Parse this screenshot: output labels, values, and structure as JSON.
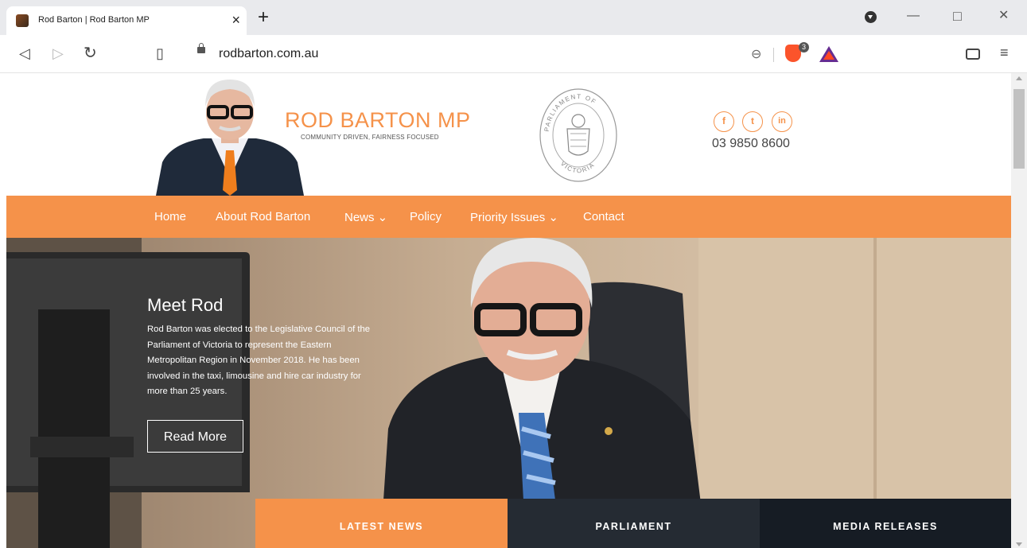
{
  "browser": {
    "tab_title": "Rod Barton | Rod Barton MP",
    "tab_close": "×",
    "new_tab": "+",
    "url": "rodbarton.com.au",
    "shields_count": "3",
    "window": {
      "minimize": "—",
      "maximize": "□",
      "close": "✕"
    },
    "nav": {
      "back": "◁",
      "forward": "▷",
      "reload": "↻",
      "bookmark": "▯",
      "zoom": "⊖",
      "menu": "≡"
    }
  },
  "header": {
    "title": "ROD BARTON MP",
    "tagline": "COMMUNITY DRIVEN, FAIRNESS FOCUSED",
    "seal_text_top": "PARLIAMENT OF",
    "seal_text_bottom": "VICTORIA",
    "social": {
      "facebook": "f",
      "twitter": "t",
      "linkedin": "in"
    },
    "phone": "03 9850 8600"
  },
  "main_nav": [
    {
      "label": "Home"
    },
    {
      "label": "About Rod Barton"
    },
    {
      "label": "News ⌄"
    },
    {
      "label": "Policy"
    },
    {
      "label": "Priority Issues ⌄"
    },
    {
      "label": "Contact"
    }
  ],
  "hero": {
    "title": "Meet Rod",
    "body": "Rod Barton was elected to the Legislative Council of the Parliament of Victoria to represent the Eastern Metropolitan Region in November 2018. He has been involved in the taxi, limousine and hire car industry for more than 25 years.",
    "button": "Read More"
  },
  "news_tabs": [
    {
      "label": "LATEST NEWS",
      "color": "#f5924a"
    },
    {
      "label": "PARLIAMENT",
      "color": "#252b33"
    },
    {
      "label": "MEDIA RELEASES",
      "color": "#161c24"
    }
  ],
  "colors": {
    "accent": "#f5924a",
    "dark": "#252b33",
    "darker": "#161c24"
  }
}
